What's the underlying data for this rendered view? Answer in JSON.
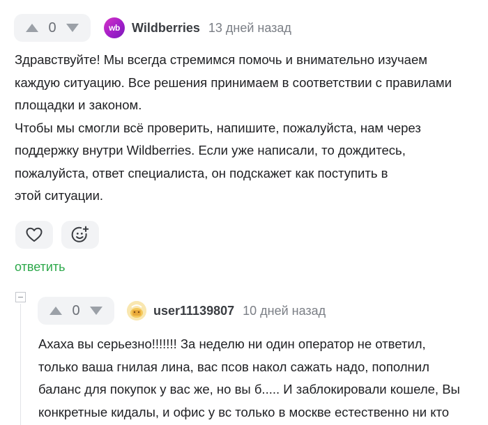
{
  "comment1": {
    "vote_count": "0",
    "author": "Wildberries",
    "logo_text": "wb",
    "time": "13 дней назад",
    "lines": [
      "Здравствуйте! Мы всегда стремимся помочь и внимательно изучаем",
      "каждую ситуацию. Все решения принимаем в соответствии с правилами",
      "площадки и законом.",
      "Чтобы мы смогли всё проверить, напишите, пожалуйста, нам через",
      "поддержку внутри Wildberries. Если уже написали, то дождитесь,",
      "пожалуйста, ответ специалиста, он подскажет как поступить в",
      "этой ситуации."
    ],
    "reply_label": "ответить"
  },
  "comment2": {
    "vote_count": "0",
    "author": "user11139807",
    "time": "10 дней назад",
    "lines": [
      "Ахаха вы серьезно!!!!!!! За неделю ни один оператор не ответил,",
      "только ваша гнилая лина, вас псов накол сажать надо, пополнил",
      "баланс для покупок у вас же, но вы б..... И заблокировали кошеле, Вы",
      "конкретные кидалы, и офис у вс только в москве естественно ни кто"
    ]
  },
  "icons": {
    "upvote": "arrow-up-icon",
    "downvote": "arrow-down-icon",
    "like": "heart-icon",
    "reaction": "add-emoji-icon",
    "collapse": "collapse-icon"
  },
  "colors": {
    "accent_green": "#2ca84a",
    "brand_purple": "#a21ec9",
    "vote_bg": "#f2f3f5"
  }
}
